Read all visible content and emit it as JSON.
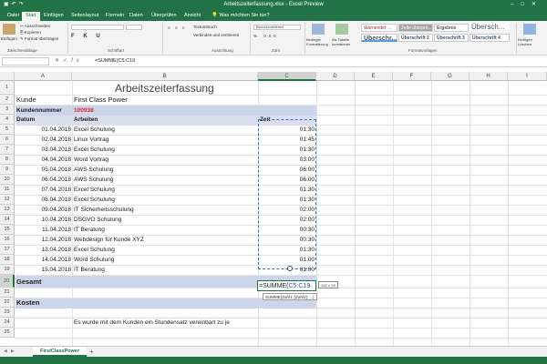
{
  "window": {
    "title": "Arbeitszeiterfassung.xlsx  -  Excel Preview",
    "qat_icons": [
      "save-icon",
      "undo-icon",
      "redo-icon"
    ]
  },
  "ribbon": {
    "tabs": [
      "Datei",
      "Start",
      "Einfügen",
      "Seitenlayout",
      "Formeln",
      "Daten",
      "Überprüfen",
      "Ansicht"
    ],
    "active_tab": "Start",
    "tell_me": "Was möchten Sie tun?",
    "clipboard": {
      "paste": "Einfügen",
      "cut": "Ausschneiden",
      "copy": "Kopieren",
      "format_painter": "Format übertragen",
      "label": "Zwischenablage"
    },
    "font_label": "Schriftart",
    "alignment": {
      "wrap": "Textumbruch",
      "merge": "Verbinden und zentrieren",
      "label": "Ausrichtung"
    },
    "number": {
      "format": "Benutzerdefiniert",
      "label": "Zahl"
    },
    "styles": {
      "conditional": "Bedingte Formatierung",
      "as_table": "Als Tabelle formatieren",
      "label": "Formatvorlagen",
      "cells": [
        "Warnender ...",
        "Zelle überprü...",
        "Ergebnis",
        "Übersch...",
        "Überschr...",
        "Überschrift 2",
        "Überschrift 3",
        "Überschrift 4"
      ]
    },
    "cells_group": {
      "insert": "Einfügen Löschen"
    }
  },
  "formula_bar": {
    "name_box": "",
    "formula": "=SUMME(C5:C19"
  },
  "columns": [
    "A",
    "B",
    "C",
    "D",
    "E",
    "F",
    "G",
    "H",
    "I"
  ],
  "rows": [
    "1",
    "2",
    "3",
    "4",
    "5",
    "6",
    "7",
    "8",
    "9",
    "10",
    "11",
    "12",
    "13",
    "14",
    "15",
    "16",
    "17",
    "18",
    "19",
    "20",
    "21",
    "22",
    "23",
    "24",
    "25"
  ],
  "sheet": {
    "title": "Arbeitszeiterfassung",
    "kunde_label": "Kunde",
    "kunde_value": "First Class Power",
    "kundennummer_label": "Kundennummer",
    "kundennummer_value": "100938",
    "headers": {
      "datum": "Datum",
      "arbeiten": "Arbeiten",
      "zeit": "Zeit"
    },
    "entries": [
      {
        "datum": "01.04.2018",
        "arbeit": "Excel Schulung",
        "zeit": "01:30"
      },
      {
        "datum": "02.04.2018",
        "arbeit": "Linux Vortrag",
        "zeit": "01:45"
      },
      {
        "datum": "03.04.2018",
        "arbeit": "Excel Schulung",
        "zeit": "01:30"
      },
      {
        "datum": "04.04.2018",
        "arbeit": "Word Vortrag",
        "zeit": "03:00"
      },
      {
        "datum": "05.04.2018",
        "arbeit": "AWS Schulung",
        "zeit": "06:00"
      },
      {
        "datum": "06.04.2018",
        "arbeit": "AWS Schulung",
        "zeit": "06:00"
      },
      {
        "datum": "07.04.2018",
        "arbeit": "Excel Schulung",
        "zeit": "01:30"
      },
      {
        "datum": "08.04.2018",
        "arbeit": "Excel Schulung",
        "zeit": "01:30"
      },
      {
        "datum": "09.04.2018",
        "arbeit": "IT Sicherheitsschulung",
        "zeit": "02:00"
      },
      {
        "datum": "10.04.2018",
        "arbeit": "DSGVO Schulung",
        "zeit": "02:00"
      },
      {
        "datum": "11.04.2018",
        "arbeit": "IT Beratung",
        "zeit": "00:30"
      },
      {
        "datum": "12.04.2018",
        "arbeit": "Webdesign für Kunde XYZ",
        "zeit": "00:30"
      },
      {
        "datum": "13.04.2018",
        "arbeit": "Excel Schulung",
        "zeit": "01:30"
      },
      {
        "datum": "14.04.2018",
        "arbeit": "Word Schulung",
        "zeit": "01:00"
      },
      {
        "datum": "15.04.2018",
        "arbeit": "IT Beratung",
        "zeit": "01:00"
      }
    ],
    "gesamt_label": "Gesamt",
    "edit_prefix": "=SUMME(",
    "edit_ref": "C5:C19",
    "function_tip": "SUMME(Zahl1; [Zahl2]; ...)",
    "size_hint": "15Z x 1S",
    "kosten_label": "Kosten",
    "note": "Es wurde mit dem Kunden ein Stundensatz vereinbart zu je"
  },
  "sheet_tabs": {
    "active": "FirstClassPower",
    "add": "+"
  },
  "colors": {
    "excel_green": "#217346",
    "band": "#cdd5ea",
    "red": "#e0252d",
    "ref_blue": "#2b50a6"
  }
}
